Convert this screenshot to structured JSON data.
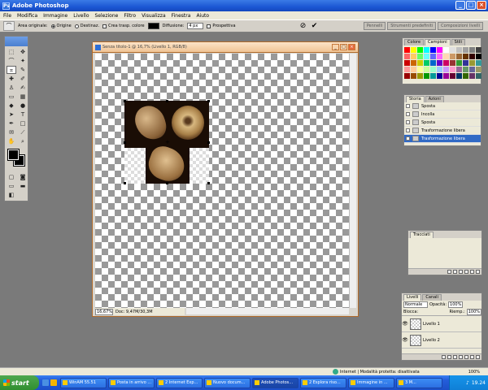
{
  "app": {
    "title": "Adobe Photoshop",
    "icon_label": "Ps"
  },
  "menu": [
    "File",
    "Modifica",
    "Immagine",
    "Livello",
    "Selezione",
    "Filtro",
    "Visualizza",
    "Finestra",
    "Aiuto"
  ],
  "options": {
    "tool_icon": "lasso-icon",
    "area_label": "Area originale:",
    "radio_origine": "Origine",
    "radio_destinazione": "Destinaz.",
    "checkbox_trasp": "Crea trasp. colore",
    "diffusione_label": "Diffusione:",
    "diffusione_value": "4 px",
    "prospettiva_label": "Prospettiva",
    "cancel_glyph": "⊘",
    "commit_glyph": "✔"
  },
  "palette_well": [
    "Pennelli",
    "Strumenti predefiniti",
    "Composizioni livelli"
  ],
  "document": {
    "title": "Senza titolo-1 @ 16,7% (Livello 1, RGB/8)",
    "zoom": "16,67%",
    "doc_info": "Doc: 9,47M/30,3M"
  },
  "color_panel": {
    "tabs": [
      "Colore",
      "Campioni",
      "Stili"
    ],
    "swatches": [
      "#ff0000",
      "#ffff00",
      "#00ff00",
      "#00ffff",
      "#0000ff",
      "#ff00ff",
      "#ffffff",
      "#e0e0e0",
      "#c0c0c0",
      "#a0a0a0",
      "#808080",
      "#404040",
      "#ff6666",
      "#ffcc66",
      "#66ff66",
      "#66ffff",
      "#6666ff",
      "#ff66ff",
      "#ffd9b3",
      "#cc9966",
      "#996633",
      "#663300",
      "#330000",
      "#000000",
      "#cc0000",
      "#cc6600",
      "#cccc00",
      "#00cc66",
      "#0066cc",
      "#6600cc",
      "#cc0066",
      "#993333",
      "#339933",
      "#333399",
      "#999933",
      "#339999",
      "#ff9999",
      "#ffcc99",
      "#ffff99",
      "#ccff99",
      "#99ffcc",
      "#99ccff",
      "#cc99ff",
      "#ff99cc",
      "#996699",
      "#669966",
      "#666699",
      "#999966",
      "#990000",
      "#994c00",
      "#999900",
      "#009900",
      "#009999",
      "#000099",
      "#990099",
      "#660033",
      "#003366",
      "#336600",
      "#663366",
      "#336666"
    ]
  },
  "history_panel": {
    "tabs": [
      "Storia",
      "Azioni"
    ],
    "items": [
      "Sposta",
      "Incolla",
      "Sposta",
      "Trasformazione libera",
      "Trasformazione libera"
    ]
  },
  "actions_panel": {
    "title": "Tracciati"
  },
  "layers_panel": {
    "tabs": [
      "Livelli",
      "Canali"
    ],
    "mode": "Normale",
    "opacity_label": "Opacità:",
    "opacity_value": "100%",
    "lock_label": "Blocca:",
    "fill_label": "Riemp.:",
    "fill_value": "100%",
    "layers": [
      {
        "name": "Livello 1",
        "visible": true
      },
      {
        "name": "Livello 2",
        "visible": true
      }
    ]
  },
  "ie_status": {
    "left": "",
    "zone": "Internet | Modalità protetta: disattivata",
    "zoom": "100%"
  },
  "taskbar": {
    "start": "start",
    "tasks": [
      "WinAM 55.51",
      "Posta in arrivo ...",
      "2 Internet Exp...",
      "Nuovo docum...",
      "Adobe Photos...",
      "2 Esplora riso...",
      "Immagine in ...",
      "3 M..."
    ],
    "active_task": 4,
    "clock": "19.24"
  }
}
